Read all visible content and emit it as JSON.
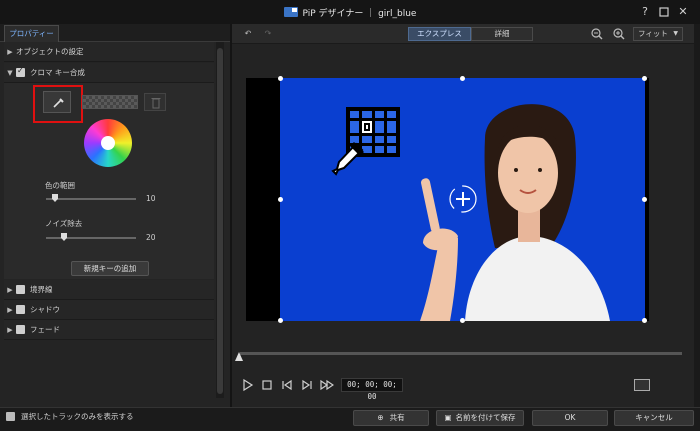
{
  "window": {
    "title": "PiP デザイナー ｜ girl_blue"
  },
  "left": {
    "tab": "プロパティー",
    "sections": {
      "object_settings": "オブジェクトの設定",
      "chroma": "クロマ キー合成",
      "border": "境界線",
      "shadow": "シャドウ",
      "fade": "フェード"
    },
    "sliders": {
      "color_range": {
        "label": "色の範囲",
        "value": "10",
        "level": 0.1
      },
      "noise": {
        "label": "ノイズ除去",
        "value": "20",
        "level": 0.2
      }
    },
    "add_key": "新規キーの追加"
  },
  "right": {
    "tabs": {
      "express": "エクスプレス",
      "detail": "詳細"
    },
    "fit": "フィット",
    "timecode": "00; 00; 00; 00"
  },
  "bottom": {
    "only_selected": "選択したトラックのみを表示する",
    "share": "共有",
    "save_as": "名前を付けて保存",
    "ok": "OK",
    "cancel": "キャンセル"
  },
  "icons": {
    "undo": "undo-icon",
    "redo": "redo-icon",
    "zoom_out": "zoom-out-icon",
    "zoom_in": "zoom-in-icon",
    "picker": "eyedropper-icon",
    "trash": "trash-icon",
    "play": "play-icon",
    "stop": "stop-icon"
  },
  "colors": {
    "chroma_background": "#0a3fd0",
    "accent": "#3a74c6",
    "highlight": "#e01010"
  }
}
